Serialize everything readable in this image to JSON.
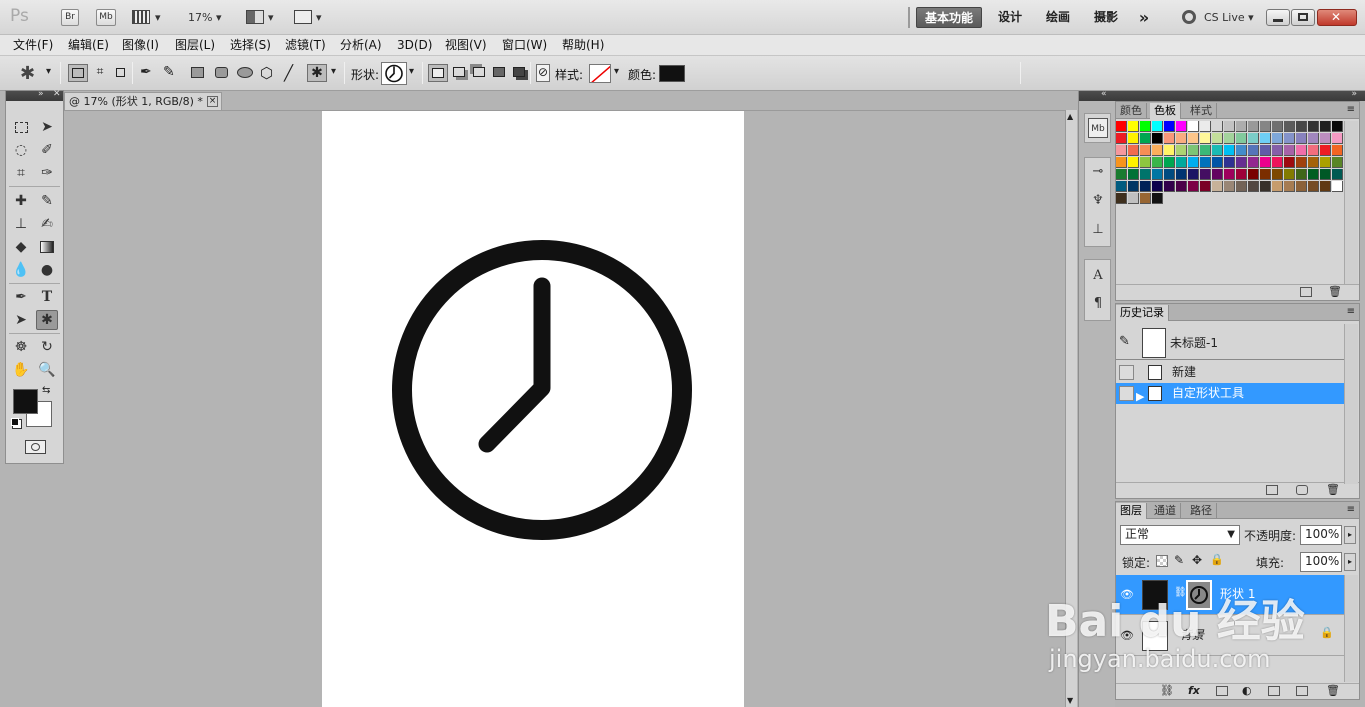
{
  "app": {
    "logo": "Ps",
    "bridge_label": "Br",
    "minibridge_label": "Mb",
    "zoom": "17%",
    "workspaces": [
      "基本功能",
      "设计",
      "绘画",
      "摄影"
    ],
    "more": "»",
    "cslive": "CS Live"
  },
  "menu": [
    "文件(F)",
    "编辑(E)",
    "图像(I)",
    "图层(L)",
    "选择(S)",
    "滤镜(T)",
    "分析(A)",
    "3D(D)",
    "视图(V)",
    "窗口(W)",
    "帮助(H)"
  ],
  "options": {
    "shape_label": "形状:",
    "style_label": "样式:",
    "color_label": "颜色:",
    "color": "#111111"
  },
  "document": {
    "tab_title": "@ 17% (形状 1, RGB/8) *",
    "close": "×"
  },
  "colors": {
    "foreground": "#111111",
    "background": "#ffffff",
    "accent": "#3399ff"
  },
  "swatch_panel": {
    "tabs": [
      "颜色",
      "色板",
      "样式"
    ],
    "active_tab": "色板",
    "swatches": [
      "#ff0000",
      "#ffff00",
      "#00ff00",
      "#00ffff",
      "#0000ff",
      "#ff00ff",
      "#ffffff",
      "#ebebeb",
      "#d6d6d6",
      "#c2c2c2",
      "#adadad",
      "#999999",
      "#858585",
      "#707070",
      "#5c5c5c",
      "#474747",
      "#333333",
      "#1f1f1f",
      "#0a0a0a",
      "#ed1c24",
      "#fff200",
      "#00a651",
      "#000000",
      "#f7977a",
      "#f9ad81",
      "#fdc68a",
      "#fff79a",
      "#c4df9b",
      "#a3d39c",
      "#82ca9d",
      "#7bcdc8",
      "#6ecff6",
      "#7ea7d8",
      "#8493ca",
      "#8882be",
      "#a187be",
      "#bc8dbf",
      "#f49ac2",
      "#f6989d",
      "#f26c4f",
      "#f68e55",
      "#fbaf5c",
      "#fff467",
      "#acd372",
      "#7cc576",
      "#3bb878",
      "#1abbb4",
      "#00bff3",
      "#438ccb",
      "#5574b9",
      "#605ca8",
      "#855fa8",
      "#a763a8",
      "#f06ea9",
      "#f26d7d",
      "#ed1c24",
      "#f26522",
      "#f7941d",
      "#fff200",
      "#8dc73f",
      "#39b54a",
      "#00a651",
      "#00a99d",
      "#00aeef",
      "#0072bc",
      "#0054a6",
      "#2e3192",
      "#662d91",
      "#92278f",
      "#ec008c",
      "#ed145b",
      "#9e0b0f",
      "#a0410d",
      "#a3620a",
      "#aba000",
      "#598527",
      "#197b30",
      "#007236",
      "#00746b",
      "#0076a3",
      "#004b80",
      "#003471",
      "#1b1464",
      "#440e62",
      "#630460",
      "#9e005d",
      "#9e0039",
      "#790000",
      "#7b2e00",
      "#7d4900",
      "#827b00",
      "#406618",
      "#005e20",
      "#005826",
      "#005952",
      "#005b7f",
      "#003663",
      "#002157",
      "#0d004c",
      "#32004b",
      "#4b0049",
      "#7b0046",
      "#7a0026",
      "#c7b299",
      "#998675",
      "#736357",
      "#534741",
      "#37302a",
      "#c69c6d",
      "#a67c52",
      "#8c6239",
      "#754c24",
      "#603913",
      "#ffffff",
      "#3e2f1d",
      "#c0c0c0",
      "#986633",
      "#111111"
    ],
    "count": 108
  },
  "history_panel": {
    "title": "历史记录",
    "snapshot": "未标题-1",
    "steps": [
      "新建",
      "自定形状工具"
    ],
    "selected_step": "自定形状工具"
  },
  "layers_panel": {
    "tabs": [
      "图层",
      "通道",
      "路径"
    ],
    "blend_mode": "正常",
    "opacity_label": "不透明度:",
    "opacity": "100%",
    "lock_label": "锁定:",
    "fill_label": "填充:",
    "fill": "100%",
    "layers": [
      {
        "name": "形状 1",
        "selected": true,
        "locked": false
      },
      {
        "name": "背景",
        "selected": false,
        "locked": true
      }
    ]
  },
  "watermark": {
    "brand": "Bai du 经验",
    "url": "jingyan.baidu.com"
  }
}
